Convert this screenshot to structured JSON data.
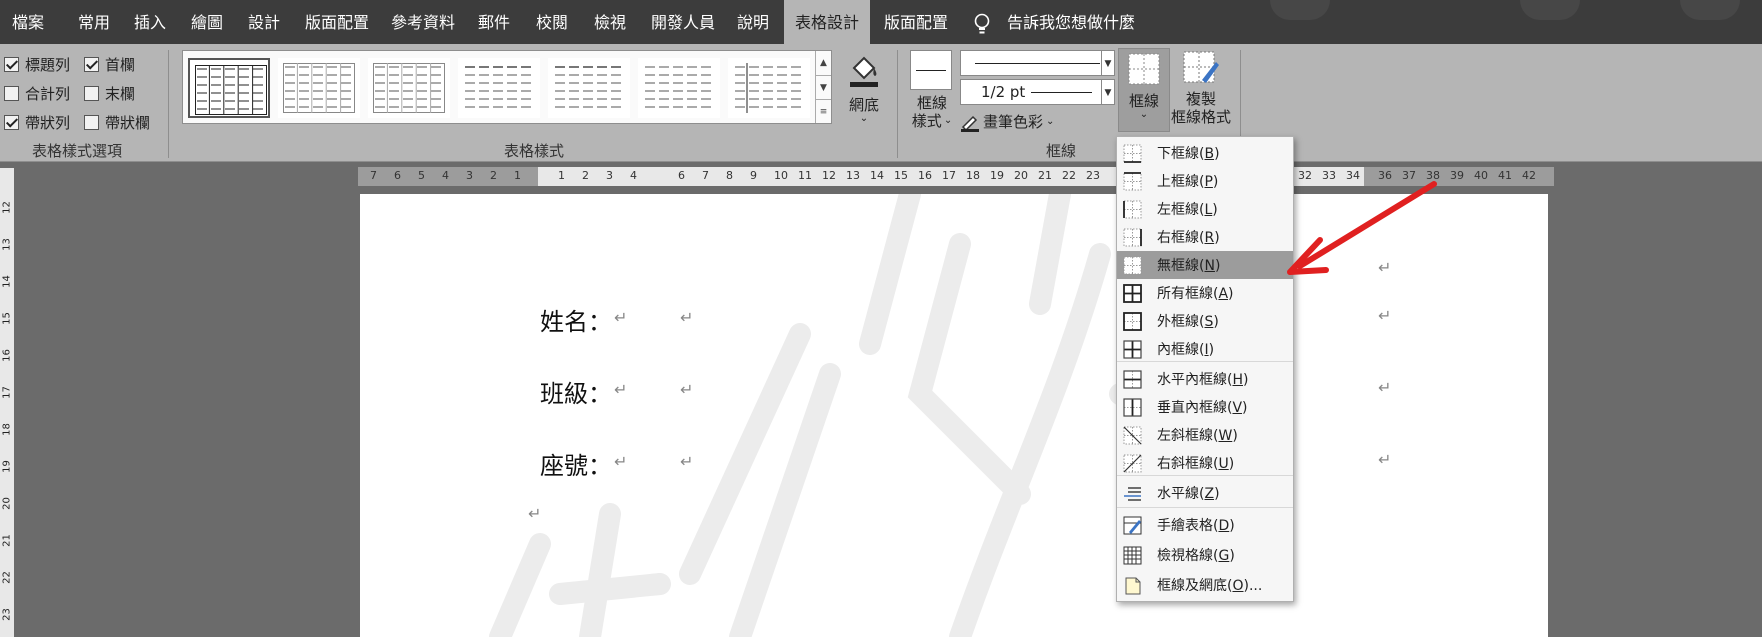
{
  "menu": {
    "tabs": [
      {
        "label": "檔案"
      },
      {
        "label": "常用"
      },
      {
        "label": "插入"
      },
      {
        "label": "繪圖"
      },
      {
        "label": "設計"
      },
      {
        "label": "版面配置"
      },
      {
        "label": "參考資料"
      },
      {
        "label": "郵件"
      },
      {
        "label": "校閱"
      },
      {
        "label": "檢視"
      },
      {
        "label": "開發人員"
      },
      {
        "label": "說明"
      },
      {
        "label": "表格設計"
      },
      {
        "label": "版面配置"
      }
    ],
    "active_tab": "表格設計",
    "tell_me": "告訴我您想做什麼"
  },
  "ribbon": {
    "options": {
      "items": [
        {
          "label": "標題列",
          "checked": true
        },
        {
          "label": "首欄",
          "checked": true
        },
        {
          "label": "合計列",
          "checked": false
        },
        {
          "label": "末欄",
          "checked": false
        },
        {
          "label": "帶狀列",
          "checked": true
        },
        {
          "label": "帶狀欄",
          "checked": false
        }
      ],
      "group_label": "表格樣式選項"
    },
    "styles": {
      "group_label": "表格樣式",
      "shading_label": "網底"
    },
    "borders": {
      "border_styles_line1": "框線",
      "border_styles_line2": "樣式",
      "line_weight": "1/2 pt",
      "pen_color": "畫筆色彩",
      "borders_button": "框線",
      "painter_line1": "複製",
      "painter_line2": "框線格式",
      "group_label": "框線"
    }
  },
  "ruler": {
    "left_nums": [
      "7",
      "6",
      "5",
      "4",
      "3",
      "2",
      "1"
    ],
    "mid1_nums": [
      "1",
      "2",
      "3",
      "4"
    ],
    "main_nums": [
      "6",
      "7",
      "8",
      "9",
      "10",
      "11",
      "12",
      "13",
      "14",
      "15",
      "16",
      "17",
      "18",
      "19",
      "20",
      "21",
      "22",
      "23"
    ],
    "right_nums": [
      "32",
      "33",
      "34"
    ],
    "far_nums": [
      "36",
      "37",
      "38",
      "39",
      "40",
      "41",
      "42"
    ],
    "v_nums": [
      "12",
      "13",
      "14",
      "15",
      "16",
      "17",
      "18",
      "19",
      "20",
      "21",
      "22",
      "23"
    ]
  },
  "document": {
    "lines": [
      "姓名：",
      "班級：",
      "座號："
    ],
    "para_mark": "↵"
  },
  "border_menu": {
    "items": [
      {
        "label": "下框線",
        "key": "B",
        "icon": "bottom-border-icon"
      },
      {
        "label": "上框線",
        "key": "P",
        "icon": "top-border-icon"
      },
      {
        "label": "左框線",
        "key": "L",
        "icon": "left-border-icon"
      },
      {
        "label": "右框線",
        "key": "R",
        "icon": "right-border-icon"
      },
      {
        "label": "無框線",
        "key": "N",
        "icon": "no-border-icon"
      },
      {
        "label": "所有框線",
        "key": "A",
        "icon": "all-borders-icon"
      },
      {
        "label": "外框線",
        "key": "S",
        "icon": "outside-borders-icon"
      },
      {
        "label": "內框線",
        "key": "I",
        "icon": "inside-borders-icon"
      },
      {
        "label": "水平內框線",
        "key": "H",
        "icon": "inside-horizontal-border-icon"
      },
      {
        "label": "垂直內框線",
        "key": "V",
        "icon": "inside-vertical-border-icon"
      },
      {
        "label": "左斜框線",
        "key": "W",
        "icon": "diagonal-down-border-icon"
      },
      {
        "label": "右斜框線",
        "key": "U",
        "icon": "diagonal-up-border-icon"
      },
      {
        "label": "水平線",
        "key": "Z",
        "icon": "horizontal-line-icon"
      },
      {
        "label": "手繪表格",
        "key": "D",
        "icon": "draw-table-icon"
      },
      {
        "label": "檢視格線",
        "key": "G",
        "icon": "view-gridlines-icon"
      },
      {
        "label": "框線及網底",
        "key": "O",
        "icon": "borders-and-shading-icon",
        "suffix": "..."
      }
    ],
    "highlighted": "無框線"
  },
  "colors": {
    "arrow": "#e02020",
    "menubar": "#3c3c3c",
    "ribbon": "#b5b5b5"
  }
}
